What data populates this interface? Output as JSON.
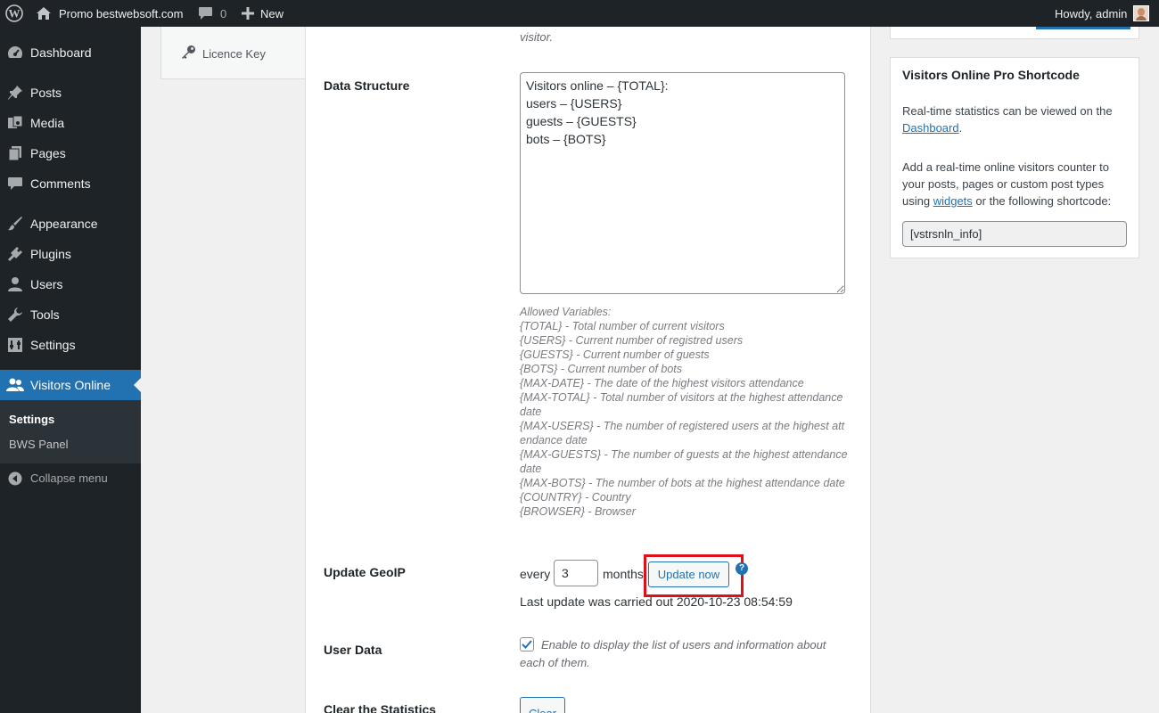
{
  "admin_bar": {
    "site_name": "Promo bestwebsoft.com",
    "comments_count": "0",
    "new_label": "New",
    "greeting": "Howdy, admin"
  },
  "sidebar": {
    "items": [
      {
        "label": "Dashboard",
        "icon": "dashboard-icon"
      },
      {
        "label": "Posts",
        "icon": "pin-icon"
      },
      {
        "label": "Media",
        "icon": "media-icon"
      },
      {
        "label": "Pages",
        "icon": "pages-icon"
      },
      {
        "label": "Comments",
        "icon": "comment-icon"
      },
      {
        "label": "Appearance",
        "icon": "brush-icon"
      },
      {
        "label": "Plugins",
        "icon": "plugin-icon"
      },
      {
        "label": "Users",
        "icon": "user-icon"
      },
      {
        "label": "Tools",
        "icon": "wrench-icon"
      },
      {
        "label": "Settings",
        "icon": "settings-icon"
      },
      {
        "label": "Visitors Online",
        "icon": "users-icon"
      }
    ],
    "submenu": [
      "Settings",
      "BWS Panel"
    ],
    "collapse_label": "Collapse menu"
  },
  "tabs": {
    "licence_key": "Licence Key"
  },
  "main": {
    "top_desc": "visitor.",
    "data_structure": {
      "label": "Data Structure",
      "value": "Visitors online – {TOTAL}:\nusers – {USERS}\nguests – {GUESTS}\nbots – {BOTS}"
    },
    "allowed_variables": [
      "Allowed Variables:",
      "{TOTAL} - Total number of current visitors",
      "{USERS} - Current number of registred users",
      "{GUESTS} - Current number of guests",
      "{BOTS} - Current number of bots",
      "{MAX-DATE} - The date of the highest visitors attendance",
      "{MAX-TOTAL} - Total number of visitors at the highest attendance date",
      "{MAX-USERS} - The number of registered users at the highest attendance date",
      "{MAX-GUESTS} - The number of guests at the highest attendance date",
      "{MAX-BOTS} - The number of bots at the highest attendance date",
      "{COUNTRY} - Country",
      "{BROWSER} - Browser"
    ],
    "geoip": {
      "label": "Update GeoIP",
      "every": "every",
      "months_value": "3",
      "months": "months",
      "button": "Update now",
      "help": "?",
      "last_update": "Last update was carried out 2020-10-23 08:54:59"
    },
    "user_data": {
      "label": "User Data",
      "checked": true,
      "desc": "Enable to display the list of users and information about each of them."
    },
    "clear": {
      "label": "Clear the Statistics",
      "button": "Clear"
    }
  },
  "shortcode_box": {
    "title": "Visitors Online Pro Shortcode",
    "text1": "Real-time statistics can be viewed on the",
    "dashboard_link": "Dashboard",
    "text2": "Add a real-time online visitors counter to your posts, pages or custom post types using",
    "widgets_link": "widgets",
    "text3": "or the following shortcode:",
    "shortcode": "[vstrsnln_info]"
  }
}
